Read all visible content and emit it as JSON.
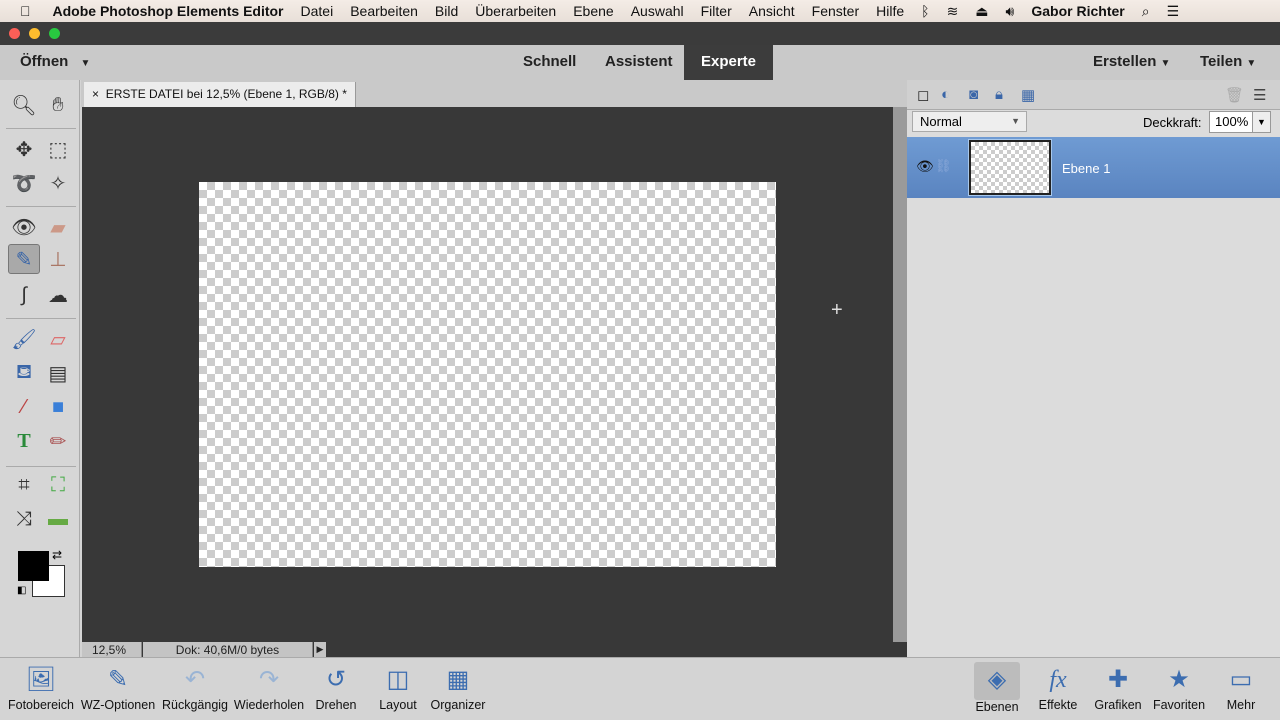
{
  "menubar": {
    "app": "Adobe Photoshop Elements Editor",
    "items": [
      "Datei",
      "Bearbeiten",
      "Bild",
      "Überarbeiten",
      "Ebene",
      "Auswahl",
      "Filter",
      "Ansicht",
      "Fenster",
      "Hilfe"
    ],
    "user": "Gabor Richter"
  },
  "topbar": {
    "open": "Öffnen",
    "modes": [
      "Schnell",
      "Assistent",
      "Experte"
    ],
    "active_mode": "Experte",
    "create": "Erstellen",
    "share": "Teilen"
  },
  "document": {
    "tab_title": "ERSTE DATEI bei 12,5% (Ebene 1, RGB/8) *",
    "zoom": "12,5%",
    "doc_info": "Dok: 40,6M/0 bytes"
  },
  "layers": {
    "blend_mode": "Normal",
    "opacity_label": "Deckkraft:",
    "opacity": "100%",
    "items": [
      {
        "name": "Ebene 1",
        "visible": true,
        "selected": true
      }
    ],
    "accent": "#6a95cf"
  },
  "bottom": {
    "left": [
      "Fotobereich",
      "WZ-Optionen",
      "Rückgängig",
      "Wiederholen",
      "Drehen",
      "Layout",
      "Organizer"
    ],
    "right": [
      "Ebenen",
      "Effekte",
      "Grafiken",
      "Favoriten",
      "Mehr"
    ]
  }
}
